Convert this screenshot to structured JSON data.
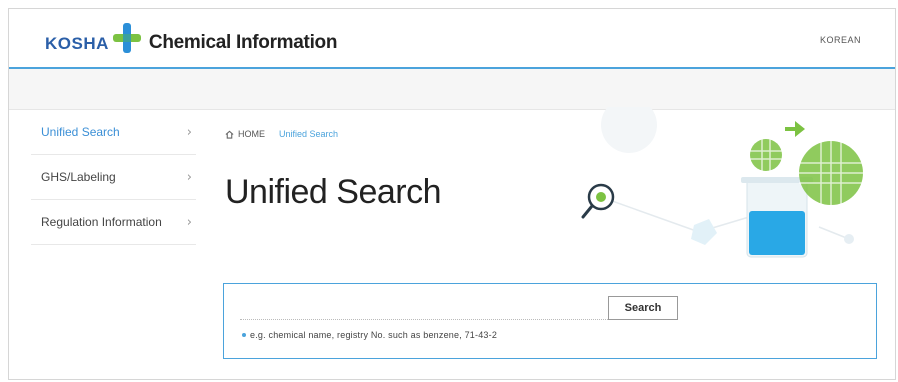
{
  "header": {
    "logo_text": "KOSHA",
    "site_title": "Chemical Information",
    "language_link": "KOREAN"
  },
  "sidebar": {
    "items": [
      {
        "label": "Unified Search",
        "active": true
      },
      {
        "label": "GHS/Labeling",
        "active": false
      },
      {
        "label": "Regulation Information",
        "active": false
      }
    ]
  },
  "breadcrumb": {
    "home": "HOME",
    "current": "Unified Search"
  },
  "page_title": "Unified Search",
  "search": {
    "value": "",
    "button_label": "Search",
    "hint": "e.g. chemical name, registry No. such as benzene, 71-43-2"
  },
  "colors": {
    "accent": "#4ba3dc",
    "logo_blue": "#2b5fa8",
    "logo_green": "#7cc242"
  },
  "icons": [
    "home-icon",
    "chevron-right-icon",
    "magnifier-icon",
    "beaker-icon",
    "arrow-icon"
  ]
}
